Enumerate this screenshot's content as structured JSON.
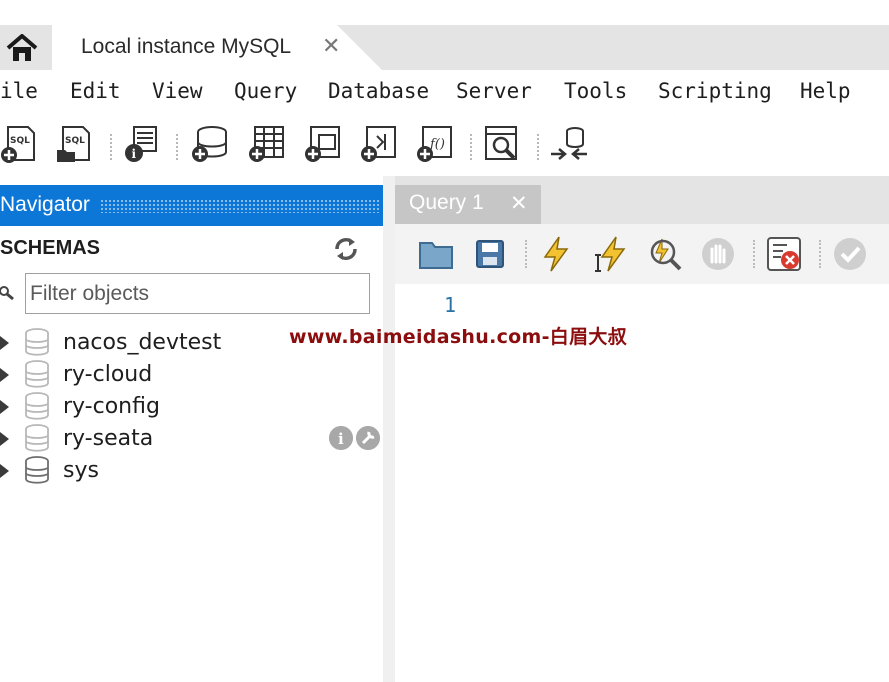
{
  "app_tabs": {
    "home_icon": "home-icon",
    "connection_tab": {
      "label": "Local instance MySQL",
      "close": "✕"
    }
  },
  "menubar": [
    "ile",
    "Edit",
    "View",
    "Query",
    "Database",
    "Server",
    "Tools",
    "Scripting",
    "Help"
  ],
  "toolbar": {
    "icons": [
      "new-sql-tab-icon",
      "open-sql-script-icon",
      "schema-inspector-icon",
      "create-schema-icon",
      "create-table-icon",
      "create-view-icon",
      "create-procedure-icon",
      "create-function-icon",
      "search-table-data-icon",
      "reconnect-icon"
    ]
  },
  "navigator": {
    "title": "Navigator",
    "schemas_label": "SCHEMAS",
    "filter_placeholder": "Filter objects",
    "schemas": [
      {
        "name": "nacos_devtest",
        "highlighted": false
      },
      {
        "name": "ry-cloud",
        "highlighted": false
      },
      {
        "name": "ry-config",
        "highlighted": false
      },
      {
        "name": "ry-seata",
        "highlighted": false
      },
      {
        "name": "sys",
        "highlighted": true
      }
    ]
  },
  "editor": {
    "tab": {
      "label": "Query 1",
      "close": "✕"
    },
    "toolbar_icons": [
      "open-file-icon",
      "save-icon",
      "execute-icon",
      "execute-current-icon",
      "explain-icon",
      "stop-icon",
      "toggle-error-icon",
      "commit-icon"
    ],
    "line_numbers": [
      "1"
    ]
  },
  "watermark": "www.baimeidashu.com-白眉大叔"
}
